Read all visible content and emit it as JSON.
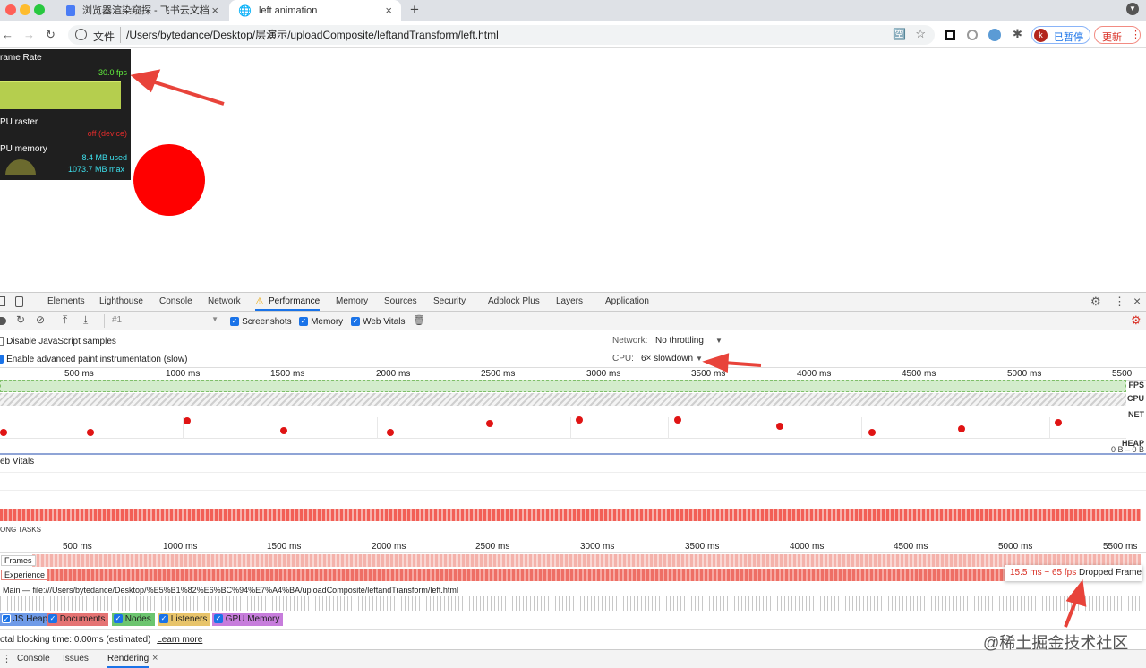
{
  "browser": {
    "tabs": [
      {
        "title": "浏览器渲染窥探 - 飞书云文档",
        "active": false
      },
      {
        "title": "left animation",
        "active": true
      }
    ],
    "new_tab": "+",
    "address": {
      "scheme_label": "文件",
      "url": "/Users/bytedance/Desktop/层演示/uploadComposite/leftandTransform/left.html"
    },
    "profile_initial": "k",
    "paused_label": "已暂停",
    "update_label": "更新"
  },
  "hud": {
    "frame_rate_label": "rame Rate",
    "fps_value": "30.0 fps",
    "gpu_raster_label": "PU raster",
    "gpu_raster_value": "off (device)",
    "gpu_memory_label": "PU memory",
    "gpu_used": "8.4 MB used",
    "gpu_max": "1073.7 MB max"
  },
  "devtools": {
    "tabs": [
      "Elements",
      "Lighthouse",
      "Console",
      "Network",
      "Performance",
      "Memory",
      "Sources",
      "Security",
      "Adblock Plus",
      "Layers",
      "Application"
    ],
    "selected_tab": "Performance",
    "recording": "#1",
    "screenshots_label": "Screenshots",
    "memory_label": "Memory",
    "web_vitals_label": "Web Vitals",
    "disable_js_samples": "Disable JavaScript samples",
    "advanced_paint": "Enable advanced paint instrumentation (slow)",
    "network_label": "Network:",
    "network_value": "No throttling",
    "cpu_label": "CPU:",
    "cpu_value": "6× slowdown",
    "overview_ticks": [
      "500 ms",
      "1000 ms",
      "1500 ms",
      "2000 ms",
      "2500 ms",
      "3000 ms",
      "3500 ms",
      "4000 ms",
      "4500 ms",
      "5000 ms",
      "5500 ms"
    ],
    "lane_labels": {
      "fps": "FPS",
      "cpu": "CPU",
      "net": "NET",
      "heap": "HEAP",
      "heap_range": "0 B – 0 B"
    },
    "web_vitals_track": "eb Vitals",
    "long_tasks": "ONG TASKS",
    "detail_ticks": [
      "500 ms",
      "1000 ms",
      "1500 ms",
      "2000 ms",
      "2500 ms",
      "3000 ms",
      "3500 ms",
      "4000 ms",
      "4500 ms",
      "5000 ms",
      "5500 ms"
    ],
    "frames_label": "Frames",
    "experience_label": "Experience",
    "main_label": "Main — file:///Users/bytedance/Desktop/%E5%B1%82%E6%BC%94%E7%A4%BA/uploadComposite/leftandTransform/left.html",
    "tooltip_timing": "15.5 ms ~ 65 fps",
    "tooltip_label": "Dropped Frame",
    "memory_legend": [
      {
        "label": "JS Heap",
        "color": "#3b82f6"
      },
      {
        "label": "Documents",
        "color": "#e57373"
      },
      {
        "label": "Nodes",
        "color": "#4caf50"
      },
      {
        "label": "Listeners",
        "color": "#e8c46a"
      },
      {
        "label": "GPU Memory",
        "color": "#c77ddc"
      }
    ],
    "tbt": "otal blocking time: 0.00ms (estimated)",
    "learn_more": "Learn more",
    "drawer_tabs": [
      "Console",
      "Issues",
      "Rendering"
    ],
    "drawer_selected": "Rendering"
  },
  "watermark": "@稀土掘金技术社区"
}
